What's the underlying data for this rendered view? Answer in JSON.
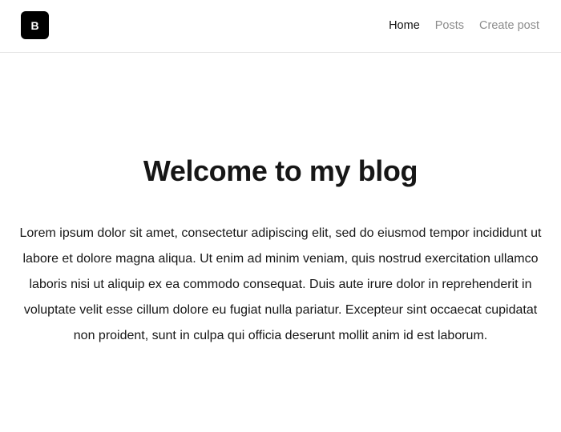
{
  "header": {
    "logo_text": "B",
    "nav": {
      "home": "Home",
      "posts": "Posts",
      "create_post": "Create post"
    }
  },
  "main": {
    "title": "Welcome to my blog",
    "body": "Lorem ipsum dolor sit amet, consectetur adipiscing elit, sed do eiusmod tempor incididunt ut labore et dolore magna aliqua. Ut enim ad minim veniam, quis nostrud exercitation ullamco laboris nisi ut aliquip ex ea commodo consequat. Duis aute irure dolor in reprehenderit in voluptate velit esse cillum dolore eu fugiat nulla pariatur. Excepteur sint occaecat cupidatat non proident, sunt in culpa qui officia deserunt mollit anim id est laborum."
  },
  "colors": {
    "logo_background": "#000000",
    "nav_active": "#111111",
    "nav_inactive": "#8c8c8c",
    "divider": "#e5e5e5"
  }
}
